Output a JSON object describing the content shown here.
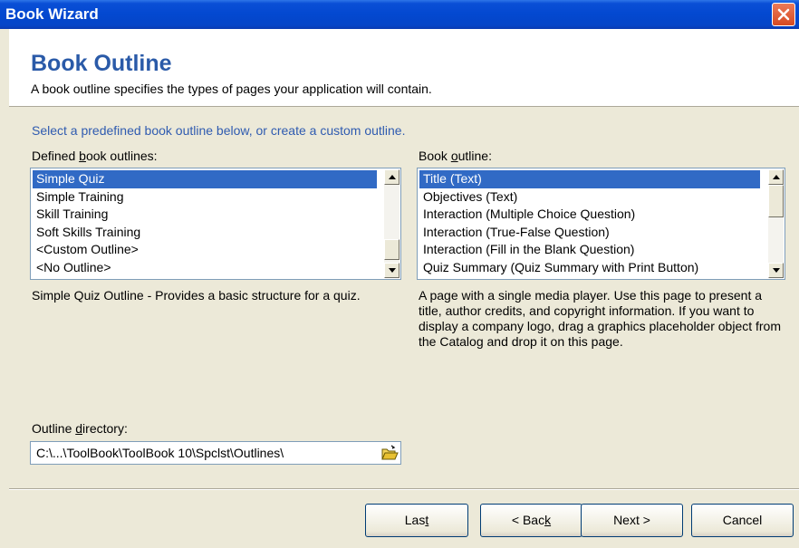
{
  "window": {
    "title": "Book Wizard"
  },
  "header": {
    "title": "Book Outline",
    "subtitle": "A book outline specifies the types of pages your application will contain."
  },
  "instruction": "Select a predefined book outline below, or create a custom outline.",
  "defined": {
    "label_pre": "Defined ",
    "label_u": "b",
    "label_post": "ook outlines:",
    "items": [
      "Simple Quiz",
      "Simple Training",
      "Skill Training",
      "Soft Skills Training",
      "<Custom Outline>",
      "<No Outline>"
    ],
    "selected": "Simple Quiz",
    "description": "Simple Quiz Outline - Provides a basic structure for a quiz."
  },
  "outline": {
    "label_pre": "Book ",
    "label_u": "o",
    "label_post": "utline:",
    "items": [
      "Title (Text)",
      "Objectives (Text)",
      "Interaction (Multiple Choice Question)",
      "Interaction (True-False Question)",
      "Interaction (Fill in the Blank Question)",
      "Quiz Summary (Quiz Summary with Print Button)"
    ],
    "selected": "Title (Text)",
    "description": "A page with a single media player. Use this page to present a title, author credits, and copyright information. If you want to display a company logo, drag a graphics placeholder object from the Catalog and drop it on this page."
  },
  "directory": {
    "label_pre": "Outline ",
    "label_u": "d",
    "label_post": "irectory:",
    "value": "C:\\...\\ToolBook\\ToolBook 10\\Spclst\\Outlines\\"
  },
  "buttons": {
    "last_pre": "Las",
    "last_u": "t",
    "last_post": "",
    "back_pre": "< Bac",
    "back_u": "k",
    "back_post": "",
    "next": "Next >",
    "cancel": "Cancel"
  },
  "colors": {
    "title_bar": "#0348d0",
    "header_title": "#2a5aa8",
    "selection": "#316ac5",
    "instruction": "#2f5bb0"
  }
}
